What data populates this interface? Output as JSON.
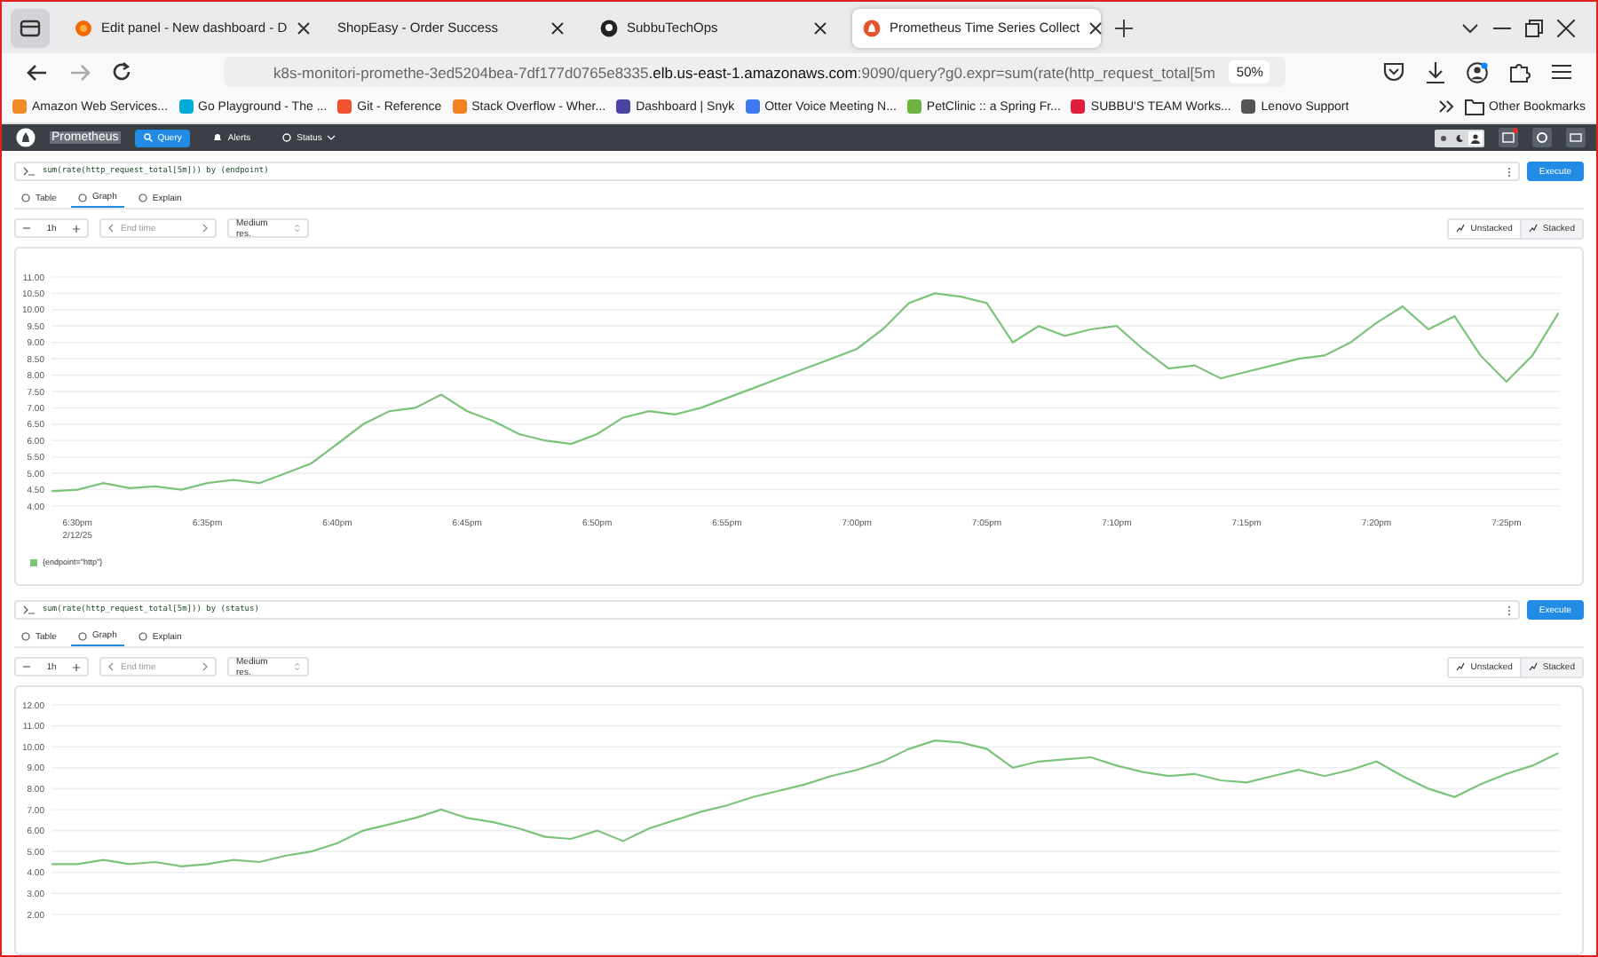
{
  "browser": {
    "tabs": [
      {
        "title": "Edit panel - New dashboard - D",
        "kind": "grafana",
        "selected": false
      },
      {
        "title": "ShopEasy - Order Success",
        "kind": "plain",
        "selected": false
      },
      {
        "title": "SubbuTechOps",
        "kind": "github",
        "selected": false
      },
      {
        "title": "Prometheus Time Series Collect",
        "kind": "prometheus",
        "selected": true
      }
    ],
    "address": {
      "host_start": "k8s-monitori-promethe-3ed5204bea-7df177d0765e8335",
      "host_domain": ".elb.us-east-1.amazonaws.com",
      "rest": ":9090/query?g0.expr=sum(rate(http_request_total[5m",
      "zoom": "50%"
    },
    "bookmarks": [
      {
        "label": "Amazon Web Services...",
        "color": "#f08a24"
      },
      {
        "label": "Go Playground - The ...",
        "color": "#00add8"
      },
      {
        "label": "Git - Reference",
        "color": "#f05133"
      },
      {
        "label": "Stack Overflow - Wher...",
        "color": "#f48024"
      },
      {
        "label": "Dashboard | Snyk",
        "color": "#4b45a1"
      },
      {
        "label": "Otter Voice Meeting N...",
        "color": "#3c7cf0"
      },
      {
        "label": "PetClinic :: a Spring Fr...",
        "color": "#6db33f"
      },
      {
        "label": "SUBBU'S TEAM Works...",
        "color": "#e01e3c"
      },
      {
        "label": "Lenovo Support",
        "color": "#555555"
      }
    ],
    "other_bookmarks": "Other Bookmarks"
  },
  "prometheus": {
    "brand": "Prometheus",
    "nav": [
      {
        "label": "Query",
        "kind": "search",
        "selected": true
      },
      {
        "label": "Alerts",
        "kind": "bell",
        "selected": false
      },
      {
        "label": "Status",
        "kind": "dropdown",
        "selected": false
      }
    ],
    "theme_modes": [
      {
        "kind": "light",
        "selected": false
      },
      {
        "kind": "dark",
        "selected": false
      },
      {
        "kind": "auto",
        "selected": true
      }
    ],
    "panels": [
      {
        "query": "sum(rate(http_request_total[5m])) by (endpoint)",
        "execute": "Execute",
        "tabs": [
          {
            "label": "Table",
            "selected": false
          },
          {
            "label": "Graph",
            "selected": true
          },
          {
            "label": "Explain",
            "selected": false
          }
        ],
        "range": "1h",
        "end_time_placeholder": "End time",
        "resolution": "Medium res.",
        "stack_modes": [
          {
            "label": "Unstacked",
            "selected": true
          },
          {
            "label": "Stacked",
            "selected": false
          }
        ],
        "x_date": "2/12/25",
        "legend": true,
        "chart_data": {
          "type": "line",
          "categories": [
            null,
            "6:30pm",
            null,
            null,
            null,
            null,
            "6:35pm",
            null,
            null,
            null,
            null,
            "6:40pm",
            null,
            null,
            null,
            null,
            "6:45pm",
            null,
            null,
            null,
            null,
            "6:50pm",
            null,
            null,
            null,
            null,
            "6:55pm",
            null,
            null,
            null,
            null,
            "7:00pm",
            null,
            null,
            null,
            null,
            "7:05pm",
            null,
            null,
            null,
            null,
            "7:10pm",
            null,
            null,
            null,
            null,
            "7:15pm",
            null,
            null,
            null,
            null,
            "7:20pm",
            null,
            null,
            null,
            null,
            "7:25pm",
            null,
            null
          ],
          "ylim": [
            4,
            11
          ],
          "grid": true,
          "yticks": [
            {
              "value": 4,
              "label": "4.00"
            },
            {
              "value": 4.5,
              "label": "4.50"
            },
            {
              "value": 5,
              "label": "5.00"
            },
            {
              "value": 5.5,
              "label": "5.50"
            },
            {
              "value": 6,
              "label": "6.00"
            },
            {
              "value": 6.5,
              "label": "6.50"
            },
            {
              "value": 7,
              "label": "7.00"
            },
            {
              "value": 7.5,
              "label": "7.50"
            },
            {
              "value": 8,
              "label": "8.00"
            },
            {
              "value": 8.5,
              "label": "8.50"
            },
            {
              "value": 9,
              "label": "9.00"
            },
            {
              "value": 9.5,
              "label": "9.50"
            },
            {
              "value": 10,
              "label": "10.00"
            },
            {
              "value": 10.5,
              "label": "10.50"
            },
            {
              "value": 11,
              "label": "11.00"
            }
          ],
          "series": [
            {
              "name": "{endpoint=\"http\"}",
              "color": "#7cc37a",
              "values": [
                4.45,
                4.5,
                4.7,
                4.55,
                4.6,
                4.5,
                4.7,
                4.8,
                4.7,
                5.0,
                5.3,
                5.9,
                6.5,
                6.9,
                7.0,
                7.4,
                6.9,
                6.6,
                6.2,
                6.0,
                5.9,
                6.2,
                6.7,
                6.9,
                6.8,
                7.0,
                7.3,
                7.6,
                7.9,
                8.2,
                8.5,
                8.8,
                9.4,
                10.2,
                10.5,
                10.4,
                10.2,
                9.0,
                9.5,
                9.2,
                9.4,
                9.5,
                8.8,
                8.2,
                8.3,
                7.9,
                8.1,
                8.3,
                8.5,
                8.6,
                9.0,
                9.6,
                10.1,
                9.4,
                9.8,
                8.6,
                7.8,
                8.6,
                9.9
              ]
            }
          ]
        }
      },
      {
        "query": "sum(rate(http_request_total[5m])) by (status)",
        "execute": "Execute",
        "tabs": [
          {
            "label": "Table",
            "selected": false
          },
          {
            "label": "Graph",
            "selected": true
          },
          {
            "label": "Explain",
            "selected": false
          }
        ],
        "range": "1h",
        "end_time_placeholder": "End time",
        "resolution": "Medium res.",
        "stack_modes": [
          {
            "label": "Unstacked",
            "selected": true
          },
          {
            "label": "Stacked",
            "selected": false
          }
        ],
        "chart_data": {
          "type": "line",
          "ylim": [
            2,
            12
          ],
          "grid": true,
          "yticks": [
            {
              "value": 2,
              "label": "2.00"
            },
            {
              "value": 3,
              "label": "3.00"
            },
            {
              "value": 4,
              "label": "4.00"
            },
            {
              "value": 5,
              "label": "5.00"
            },
            {
              "value": 6,
              "label": "6.00"
            },
            {
              "value": 7,
              "label": "7.00"
            },
            {
              "value": 8,
              "label": "8.00"
            },
            {
              "value": 9,
              "label": "9.00"
            },
            {
              "value": 10,
              "label": "10.00"
            },
            {
              "value": 11,
              "label": "11.00"
            },
            {
              "value": 12,
              "label": "12.00"
            }
          ],
          "series": [
            {
              "color": "#7cc37a",
              "values": [
                4.4,
                4.4,
                4.6,
                4.4,
                4.5,
                4.3,
                4.4,
                4.6,
                4.5,
                4.8,
                5.0,
                5.4,
                6.0,
                6.3,
                6.6,
                7.0,
                6.6,
                6.4,
                6.1,
                5.7,
                5.6,
                6.0,
                5.5,
                6.1,
                6.5,
                6.9,
                7.2,
                7.6,
                7.9,
                8.2,
                8.6,
                8.9,
                9.3,
                9.9,
                10.3,
                10.2,
                9.9,
                9.0,
                9.3,
                9.4,
                9.5,
                9.1,
                8.8,
                8.6,
                8.7,
                8.4,
                8.3,
                8.6,
                8.9,
                8.6,
                8.9,
                9.3,
                8.6,
                8.0,
                7.6,
                8.2,
                8.7,
                9.1,
                9.7
              ]
            }
          ]
        }
      }
    ]
  }
}
